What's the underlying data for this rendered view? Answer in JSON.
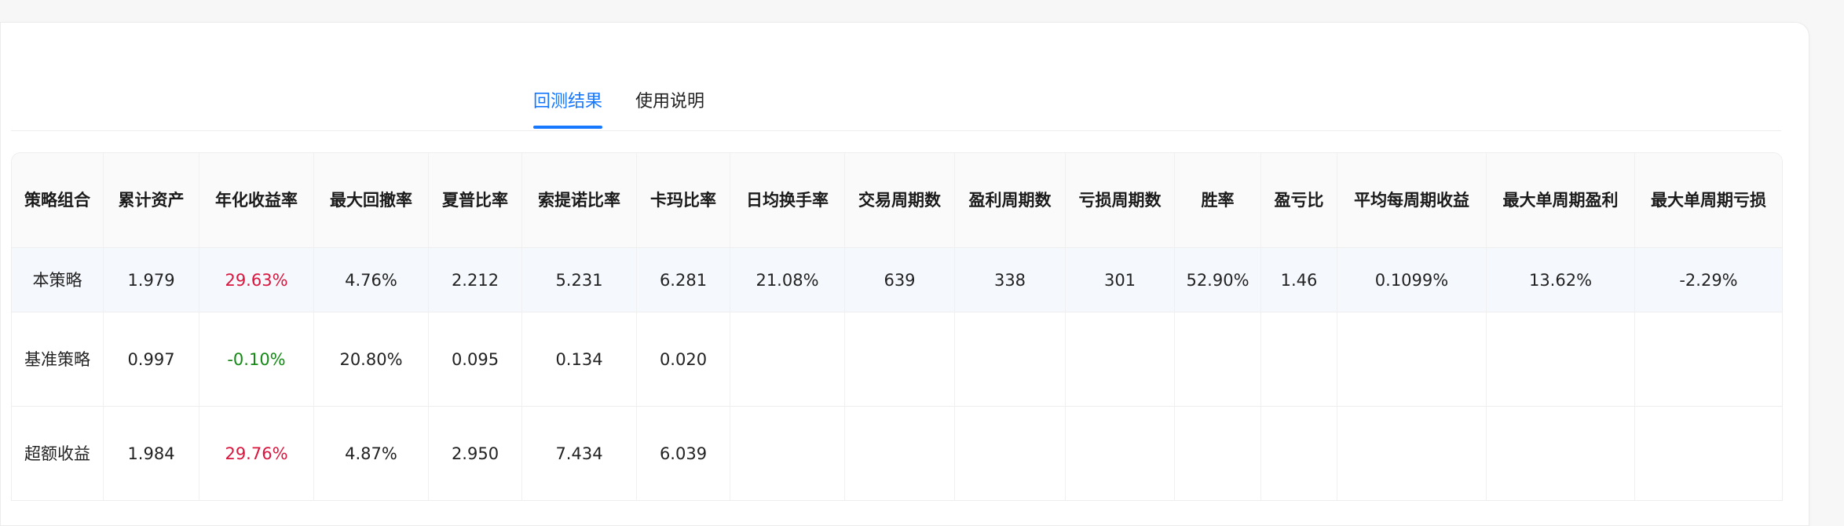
{
  "tabs": [
    {
      "label": "回测结果",
      "active": true
    },
    {
      "label": "使用说明",
      "active": false
    }
  ],
  "colors": {
    "accent": "#1677ff",
    "positive": "#d9163e",
    "negative": "#138a13"
  },
  "table": {
    "headers": [
      "策略组合",
      "累计资产",
      "年化收益率",
      "最大回撤率",
      "夏普比率",
      "索提诺比率",
      "卡玛比率",
      "日均换手率",
      "交易周期数",
      "盈利周期数",
      "亏损周期数",
      "胜率",
      "盈亏比",
      "平均每周期收益",
      "最大单周期盈利",
      "最大单周期亏损"
    ],
    "rows": [
      [
        "本策略",
        "1.979",
        "29.63%",
        "4.76%",
        "2.212",
        "5.231",
        "6.281",
        "21.08%",
        "639",
        "338",
        "301",
        "52.90%",
        "1.46",
        "0.1099%",
        "13.62%",
        "-2.29%"
      ],
      [
        "基准策略",
        "0.997",
        "-0.10%",
        "20.80%",
        "0.095",
        "0.134",
        "0.020",
        "",
        "",
        "",
        "",
        "",
        "",
        "",
        "",
        ""
      ],
      [
        "超额收益",
        "1.984",
        "29.76%",
        "4.87%",
        "2.950",
        "7.434",
        "6.039",
        "",
        "",
        "",
        "",
        "",
        "",
        "",
        "",
        ""
      ]
    ]
  }
}
